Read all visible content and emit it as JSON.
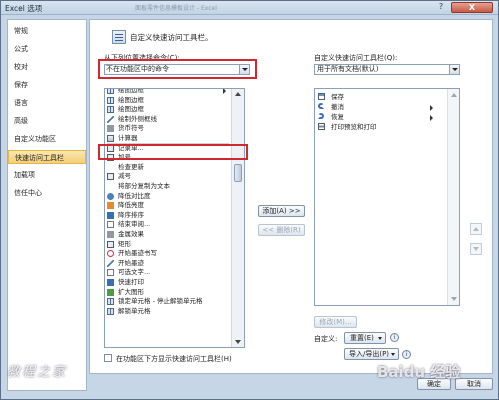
{
  "window": {
    "title": "Excel 选项",
    "help": "?",
    "close": "X",
    "background_text": "面板零件信息模板设计 - Excel"
  },
  "nav": {
    "items": [
      {
        "label": "常规"
      },
      {
        "label": "公式"
      },
      {
        "label": "校对"
      },
      {
        "label": "保存"
      },
      {
        "label": "语言"
      },
      {
        "label": "高级"
      },
      {
        "label": "自定义功能区"
      },
      {
        "label": "快速访问工具栏",
        "active": true
      },
      {
        "label": "加载项"
      },
      {
        "label": "信任中心"
      }
    ]
  },
  "header": {
    "text": "自定义快速访问工具栏。"
  },
  "left": {
    "label": "从下列位置选择命令(C):",
    "dropdown_value": "不在功能区中的命令",
    "commands": [
      {
        "label": "绘图边框",
        "icon": "grid",
        "sub": true
      },
      {
        "label": "绘图边框",
        "icon": "grid"
      },
      {
        "label": "绘图边框",
        "icon": "grid"
      },
      {
        "label": "绘制外侧框线",
        "icon": "pen"
      },
      {
        "label": "货币符号",
        "icon": "grey"
      },
      {
        "label": "计算器",
        "icon": "calc"
      },
      {
        "label": "记录单...",
        "icon": "sq"
      },
      {
        "label": "加号",
        "icon": "sq"
      },
      {
        "label": "检查更新",
        "icon": "none"
      },
      {
        "label": "减号",
        "icon": "sq"
      },
      {
        "label": "将部分复制为文本",
        "icon": "none"
      },
      {
        "label": "降低对比度",
        "icon": "dot"
      },
      {
        "label": "降低亮度",
        "icon": "orange"
      },
      {
        "label": "降序排序",
        "icon": "blue"
      },
      {
        "label": "结束审阅...",
        "icon": "doc"
      },
      {
        "label": "金属效果",
        "icon": "grey"
      },
      {
        "label": "矩形",
        "icon": "sq"
      },
      {
        "label": "开始墨迹书写",
        "icon": "red"
      },
      {
        "label": "开始墨迹",
        "icon": "pen"
      },
      {
        "label": "可选文字...",
        "icon": "doc"
      },
      {
        "label": "快速打印",
        "icon": "blue"
      },
      {
        "label": "扩大图形",
        "icon": "green"
      },
      {
        "label": "锁定单元格 - 停止解锁单元格",
        "icon": "grid"
      },
      {
        "label": "解锁单元格",
        "icon": "grid"
      }
    ]
  },
  "right": {
    "label": "自定义快速访问工具栏(Q):",
    "dropdown_value": "用于所有文档(默认)",
    "items": [
      {
        "label": "保存",
        "icon": "save"
      },
      {
        "label": "撤消",
        "icon": "undo",
        "sub": true
      },
      {
        "label": "恢复",
        "icon": "redo",
        "sub": true
      },
      {
        "label": "打印预览和打印",
        "icon": "print"
      }
    ]
  },
  "buttons": {
    "add": "添加(A) >>",
    "remove": "<< 删除(R)",
    "modify": "修改(M)...",
    "customize_label": "自定义:",
    "reset": "重置(E)",
    "import_export": "导入/导出(P)",
    "ok": "确定",
    "cancel": "取消",
    "info": "i"
  },
  "checkbox": {
    "label": "在功能区下方显示快速访问工具栏(H)"
  },
  "watermarks": {
    "left": "教程之家",
    "right": "Baidu 经验"
  }
}
